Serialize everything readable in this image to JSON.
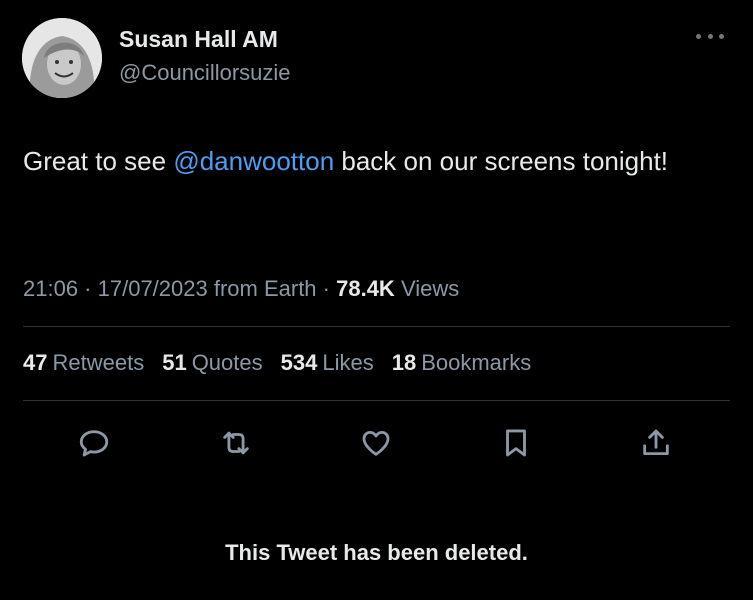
{
  "author": {
    "display_name": "Susan Hall AM",
    "handle": "@Councillorsuzie"
  },
  "tweet": {
    "text_before": "Great to see ",
    "mention": "@danwootton",
    "text_after": " back on our screens tonight!"
  },
  "meta": {
    "time": "21:06",
    "sep1": " · ",
    "date": "17/07/2023",
    "source": " from Earth",
    "sep2": " · ",
    "views_count": "78.4K",
    "views_label": " Views"
  },
  "stats": {
    "retweets_count": "47",
    "retweets_label": "Retweets",
    "quotes_count": "51",
    "quotes_label": "Quotes",
    "likes_count": "534",
    "likes_label": "Likes",
    "bookmarks_count": "18",
    "bookmarks_label": "Bookmarks"
  },
  "actions": [
    "reply-icon",
    "retweet-icon",
    "like-icon",
    "bookmark-icon",
    "share-icon"
  ],
  "colors": {
    "background": "#000000",
    "text": "#e7e9ea",
    "secondary": "#8b98a5",
    "link": "#4a9ff5"
  },
  "status_message": "This Tweet has been deleted."
}
